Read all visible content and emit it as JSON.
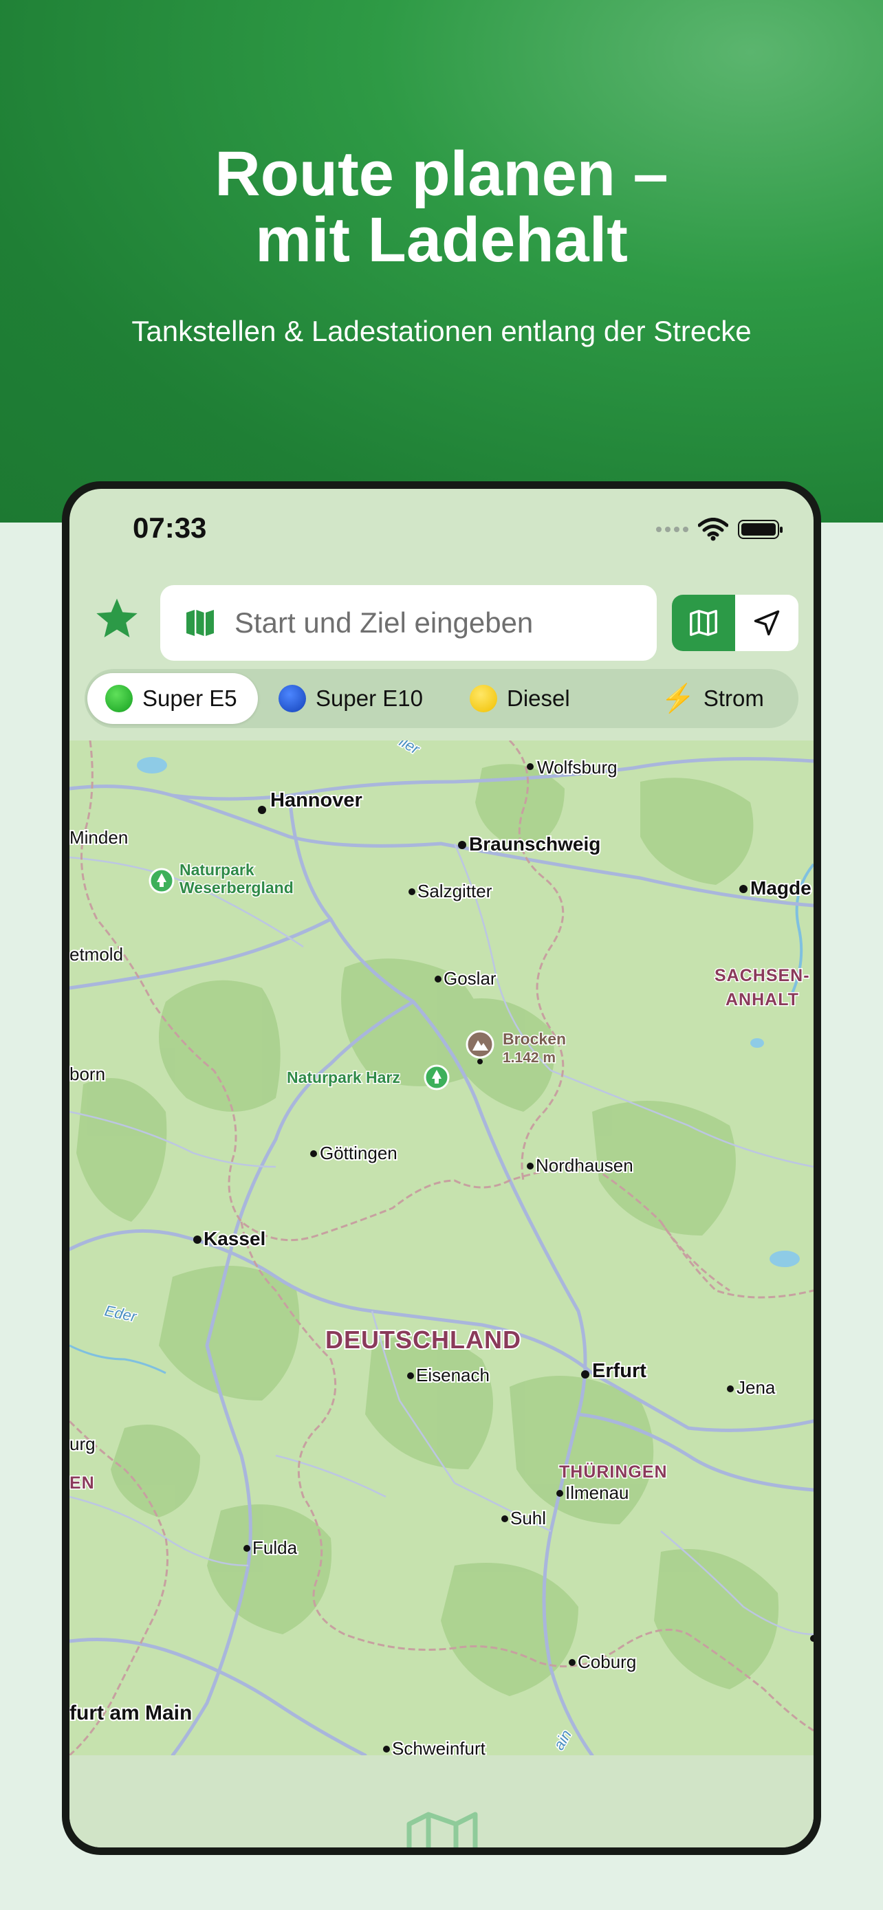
{
  "hero": {
    "title": "Route planen –\nmit Ladehalt",
    "subtitle": "Tankstellen & Ladestationen entlang der Strecke"
  },
  "status_bar": {
    "time": "07:33"
  },
  "search": {
    "placeholder": "Start und Ziel eingeben",
    "favorite_icon": "star-icon",
    "map_mode_icon": "map-icon",
    "location_icon": "location-arrow-icon"
  },
  "fuel_types": [
    {
      "label": "Super E5",
      "color": "#1db12a",
      "selected": true
    },
    {
      "label": "Super E10",
      "color": "#1a55d0",
      "selected": false
    },
    {
      "label": "Diesel",
      "color": "#f7cf14",
      "selected": false
    },
    {
      "label": "Strom",
      "color": "#f2b318",
      "icon": "lightning-icon",
      "selected": false
    }
  ],
  "map": {
    "cities": {
      "hannover": "Hannover",
      "wolfsburg": "Wolfsburg",
      "minden": "Minden",
      "braunschweig": "Braunschweig",
      "salzgitter": "Salzgitter",
      "magdeburg": "Magde",
      "detmold": "etmold",
      "goslar": "Goslar",
      "paderborn": "born",
      "goettingen": "Göttingen",
      "nordhausen": "Nordhausen",
      "kassel": "Kassel",
      "eisenach": "Eisenach",
      "erfurt": "Erfurt",
      "jena": "Jena",
      "marburg": "urg",
      "ilmenau": "Ilmenau",
      "suhl": "Suhl",
      "fulda": "Fulda",
      "coburg": "Coburg",
      "frankfurt": "furt am Main",
      "schweinfurt": "Schweinfurt"
    },
    "regions": {
      "sachsen_anhalt_1": "SACHSEN-",
      "sachsen_anhalt_2": "ANHALT",
      "thueringen": "THÜRINGEN",
      "hessen": "EN",
      "country": "DEUTSCHLAND"
    },
    "parks": {
      "weserbergland_1": "Naturpark",
      "weserbergland_2": "Weserbergland",
      "harz": "Naturpark Harz"
    },
    "peak": {
      "name": "Brocken",
      "elevation": "1.142 m"
    },
    "rivers": {
      "eder": "Eder",
      "aller": "ller",
      "main": "ain"
    }
  }
}
